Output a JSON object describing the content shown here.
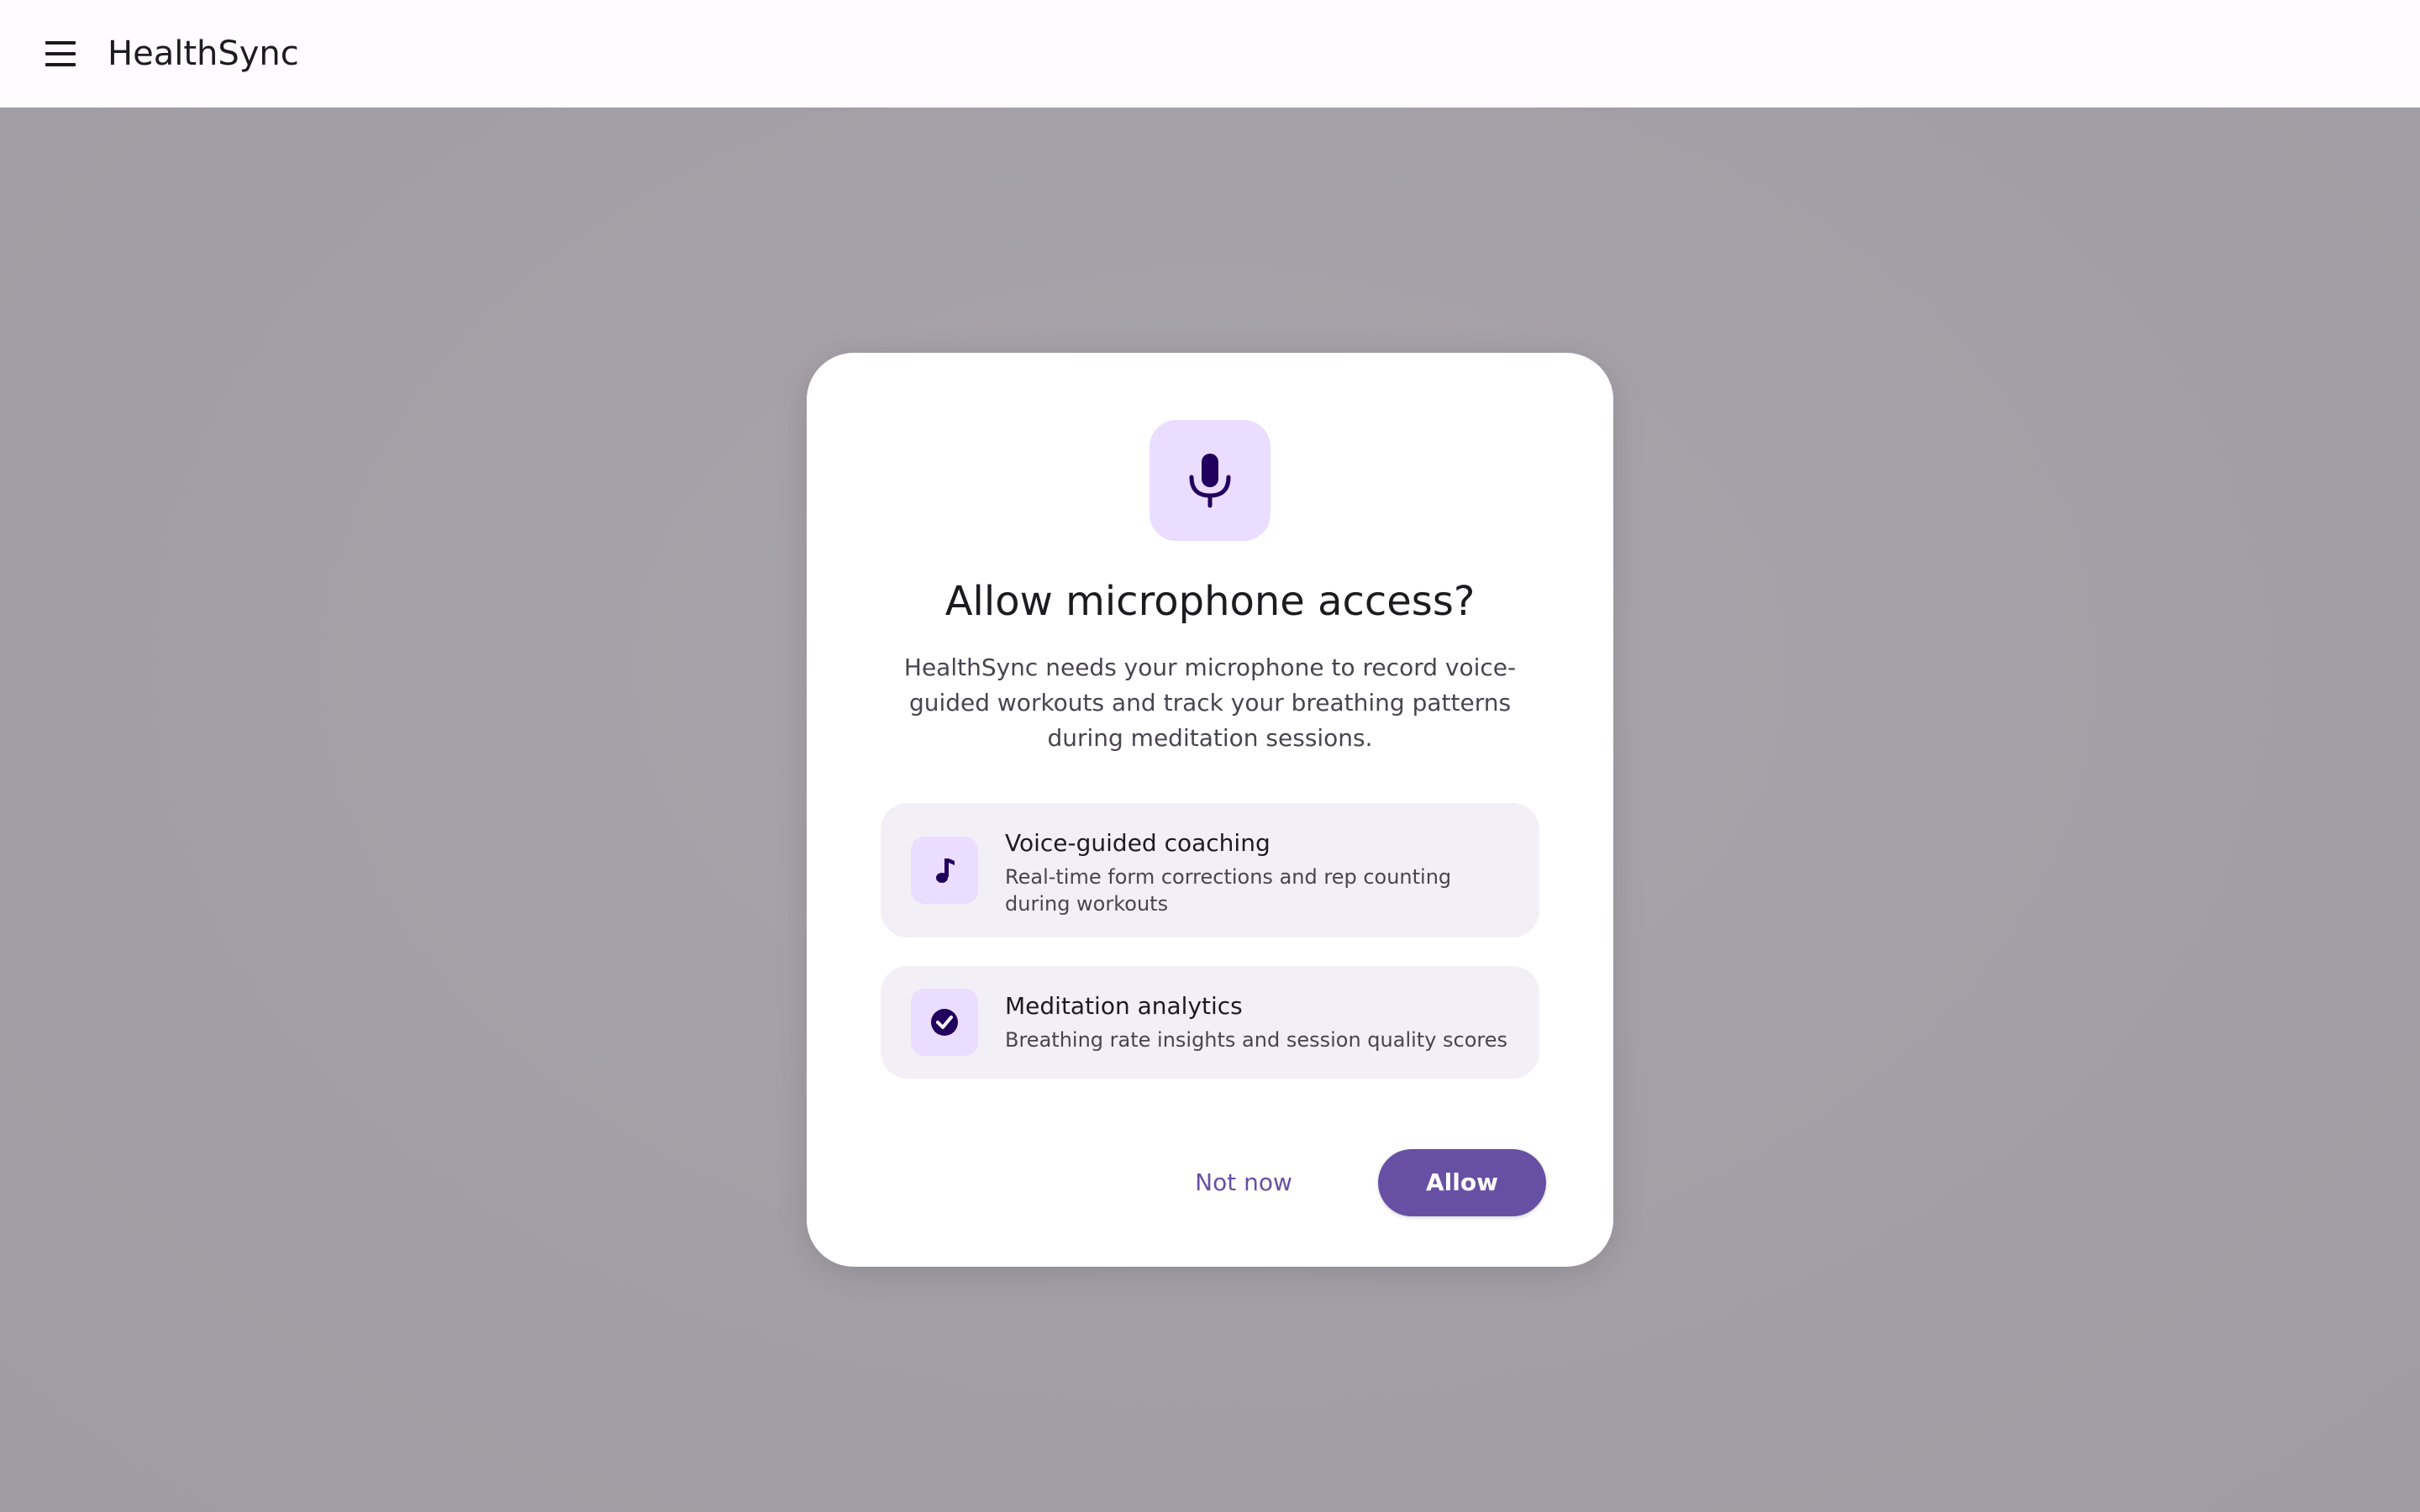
{
  "app": {
    "title": "HealthSync"
  },
  "topbar": {
    "menu_icon": "menu-icon"
  },
  "dialog": {
    "icon": "microphone-icon",
    "title": "Allow microphone access?",
    "description": "HealthSync needs your microphone to record voice-guided workouts and track your breathing patterns during meditation sessions.",
    "features": [
      {
        "icon": "music-note-icon",
        "title": "Voice-guided coaching",
        "subtitle": "Real-time form corrections and rep counting during workouts"
      },
      {
        "icon": "check-circle-icon",
        "title": "Meditation analytics",
        "subtitle": "Breathing rate insights and session quality scores"
      }
    ],
    "buttons": {
      "dismiss_label": "Not now",
      "confirm_label": "Allow"
    }
  },
  "colors": {
    "primary": "#6750a4",
    "primary_container": "#eaddff",
    "on_primary_container": "#21005d",
    "surface": "#ffffff",
    "surface_variant": "#f3eff6",
    "scrim": "#a39fa6",
    "on_surface": "#1c1b1f",
    "on_surface_variant": "#49454f"
  }
}
